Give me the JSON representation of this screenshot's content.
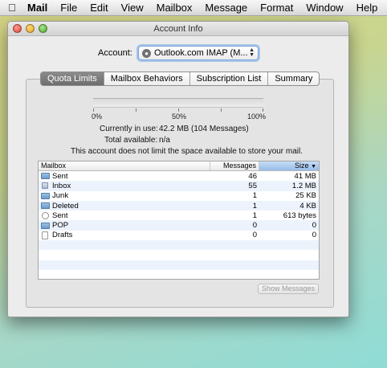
{
  "menubar": {
    "apple_icon": "apple-logo-icon",
    "items": [
      "Mail",
      "File",
      "Edit",
      "View",
      "Mailbox",
      "Message",
      "Format",
      "Window",
      "Help"
    ]
  },
  "window": {
    "title": "Account Info",
    "account_label": "Account:",
    "account_value": "Outlook.com IMAP (M...",
    "tabs": [
      "Quota Limits",
      "Mailbox Behaviors",
      "Subscription List",
      "Summary"
    ],
    "active_tab": "Quota Limits",
    "quota": {
      "used_fraction": 0.0,
      "tick_labels": [
        "0%",
        "50%",
        "100%"
      ],
      "currently_in_use_label": "Currently in use:",
      "currently_in_use_value": "42.2 MB (104 Messages)",
      "total_available_label": "Total available:",
      "total_available_value": "n/a",
      "note": "This account does not limit the space available to store your mail."
    },
    "table": {
      "columns": [
        "Mailbox",
        "Messages",
        "Size"
      ],
      "sort_column": "Size",
      "rows": [
        {
          "icon": "folder-icon",
          "mailbox": "Sent",
          "messages": "46",
          "size": "41 MB"
        },
        {
          "icon": "inbox-icon",
          "mailbox": "Inbox",
          "messages": "55",
          "size": "1.2 MB"
        },
        {
          "icon": "folder-icon",
          "mailbox": "Junk",
          "messages": "1",
          "size": "25 KB"
        },
        {
          "icon": "folder-icon",
          "mailbox": "Deleted",
          "messages": "1",
          "size": "4 KB"
        },
        {
          "icon": "sent-icon",
          "mailbox": "Sent",
          "messages": "1",
          "size": "613 bytes"
        },
        {
          "icon": "folder-icon",
          "mailbox": "POP",
          "messages": "0",
          "size": "0"
        },
        {
          "icon": "document-icon",
          "mailbox": "Drafts",
          "messages": "0",
          "size": "0"
        }
      ]
    },
    "show_messages_label": "Show Messages"
  },
  "colors": {
    "tab_active": "#6d6d6d",
    "sort_header": "#98bde9",
    "row_stripe": "#edf3fd"
  }
}
